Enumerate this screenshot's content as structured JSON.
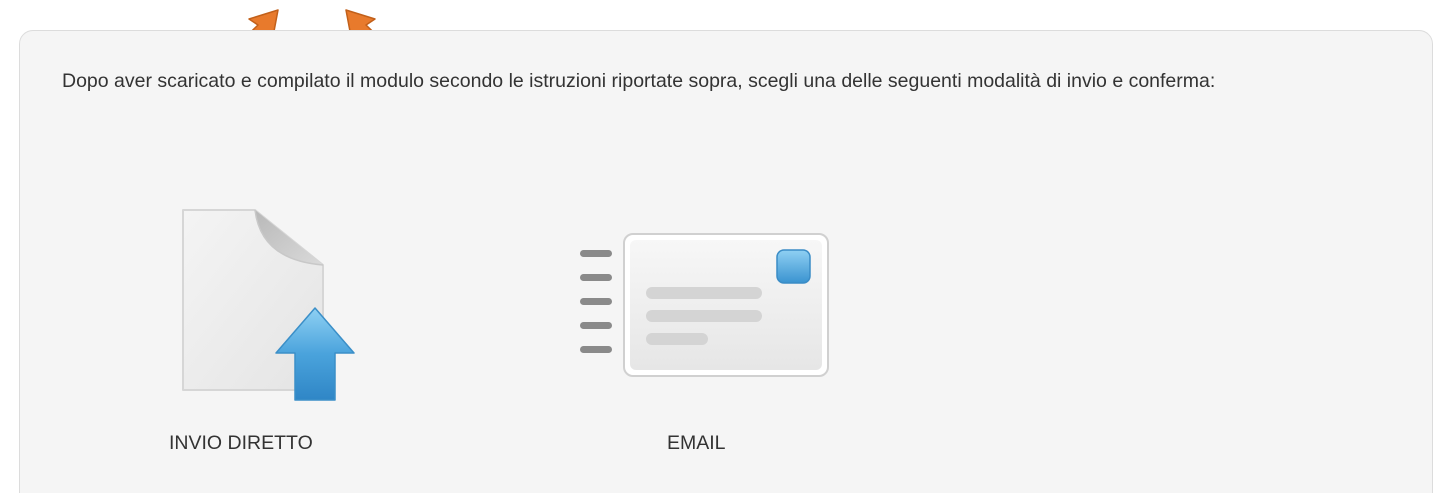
{
  "instructions": "Dopo aver scaricato e compilato il modulo secondo le istruzioni riportate sopra, scegli una delle seguenti modalità di invio e conferma:",
  "options": [
    {
      "label": "INVIO DIRETTO",
      "icon": "document-upload-icon"
    },
    {
      "label": "EMAIL",
      "icon": "email-envelope-icon"
    }
  ],
  "colors": {
    "panel_background": "#f5f5f5",
    "panel_border": "#dcdcdc",
    "text": "#333333",
    "accent_blue": "#4aa3dc",
    "annotation_arrow": "#e87a2c"
  },
  "annotations": {
    "arrows": [
      "annotation-arrow-icon",
      "annotation-arrow-icon"
    ]
  }
}
